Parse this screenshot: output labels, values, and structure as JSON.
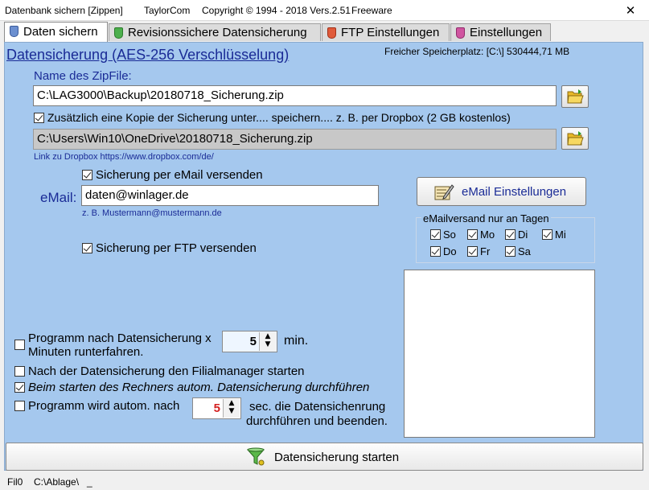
{
  "window": {
    "title": "Datenbank sichern [Zippen]",
    "company": "TaylorCom",
    "copyright": "Copyright © 1994 - 2018 Vers.2.51",
    "license": "Freeware",
    "close_glyph": "✕"
  },
  "tabs": [
    {
      "label": "Daten sichern",
      "icon": "clipboard-icon",
      "color": "#4a6fb5",
      "active": true
    },
    {
      "label": "Revisionssichere Datensicherung",
      "icon": "green-doc-icon",
      "color": "#3c9b3c",
      "active": false
    },
    {
      "label": "FTP Einstellungen",
      "icon": "red-doc-icon",
      "color": "#d2472b",
      "active": false
    },
    {
      "label": "Einstellungen",
      "icon": "pink-doc-icon",
      "color": "#c83c8c",
      "active": false
    }
  ],
  "main": {
    "heading": "Datensicherung (AES-256 Verschlüsselung)",
    "free_space": "Freicher Speicherplatz: [C:\\] 530444,71 MB",
    "zip_label": "Name des ZipFile:",
    "zip_path": "C:\\LAG3000\\Backup\\20180718_Sicherung.zip",
    "copy_checkbox": {
      "label": "Zusätzlich eine Kopie der Sicherung unter.... speichern.... z. B. per Dropbox (2 GB kostenlos)",
      "checked": true
    },
    "copy_path": "C:\\Users\\Win10\\OneDrive\\20180718_Sicherung.zip",
    "dropbox_link": "Link zu Dropbox https://www.dropbox.com/de/",
    "email_checkbox": {
      "label": "Sicherung per eMail versenden",
      "checked": true
    },
    "email_label": "eMail:",
    "email_value": "daten@winlager.de",
    "email_hint": "z. B. Mustermann@mustermann.de",
    "email_settings_button": "eMail Einstellungen",
    "ftp_checkbox": {
      "label": "Sicherung per FTP versenden",
      "checked": true
    },
    "days_group": {
      "title": "eMailversand nur an Tagen",
      "days": [
        {
          "label": "So",
          "checked": true
        },
        {
          "label": "Mo",
          "checked": true
        },
        {
          "label": "Di",
          "checked": true
        },
        {
          "label": "Mi",
          "checked": true
        },
        {
          "label": "Do",
          "checked": true
        },
        {
          "label": "Fr",
          "checked": true
        },
        {
          "label": "Sa",
          "checked": true
        }
      ]
    },
    "shutdown": {
      "label_line1": "Programm nach Datensicherung x",
      "label_line2": "Minuten runterfahren.",
      "checked": false,
      "value": "5",
      "unit": "min."
    },
    "filialmanager": {
      "label": "Nach der Datensicherung den Filialmanager starten",
      "checked": false
    },
    "autostart": {
      "label": "Beim starten des Rechners autom. Datensicherung durchführen",
      "checked": true
    },
    "auto_program": {
      "label": "Programm wird autom. nach",
      "checked": false,
      "value": "5",
      "suffix_line1": "sec. die Datensichenrung",
      "suffix_line2": "durchführen und beenden."
    },
    "start_button": "Datensicherung starten"
  },
  "status": {
    "field1": "Fil0",
    "field2": "C:\\Ablage\\",
    "field3": "_"
  },
  "colors": {
    "panel_bg": "#a5c8ee",
    "heading_blue": "#1a2b96",
    "spin_value_red": "#d42020"
  }
}
